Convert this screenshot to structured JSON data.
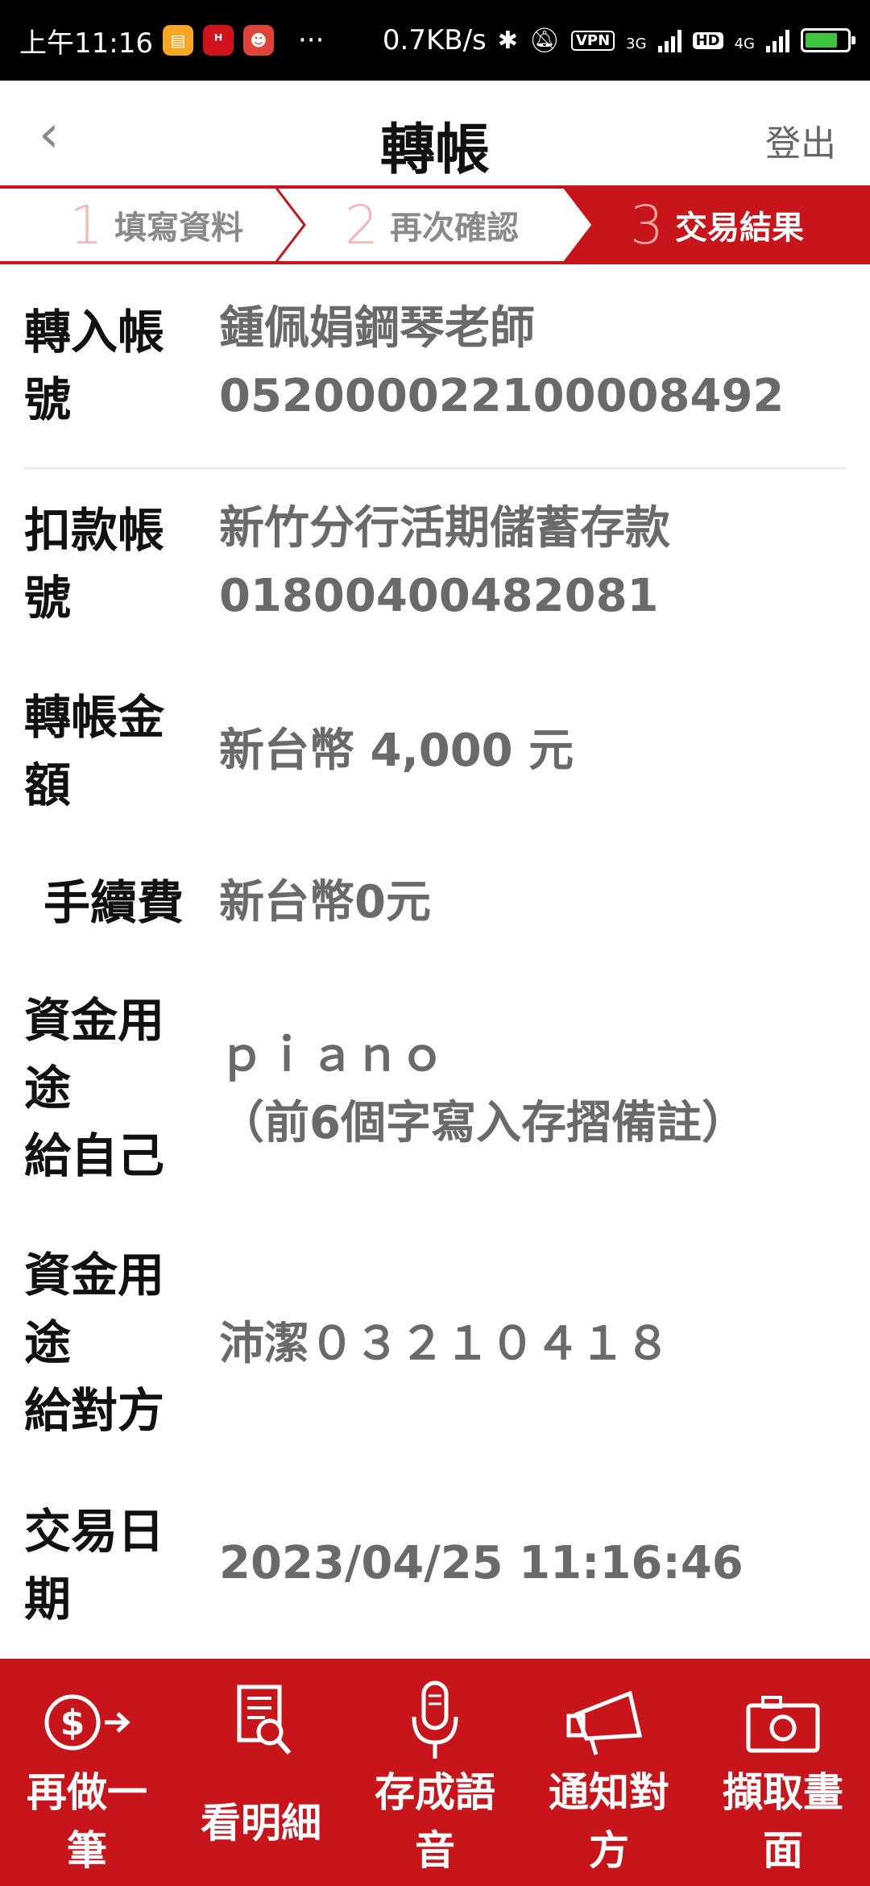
{
  "status_bar": {
    "time": "上午11:16",
    "dots": "···",
    "speed": "0.7KB/s",
    "vpn": "VPN",
    "net1": "3G",
    "hd": "HD",
    "net2": "4G"
  },
  "header": {
    "back_icon": "chevron-left-icon",
    "title": "轉帳",
    "logout_label": "登出"
  },
  "stepper": {
    "steps": [
      {
        "num": "1",
        "label": "填寫資料"
      },
      {
        "num": "2",
        "label": "再次確認"
      },
      {
        "num": "3",
        "label": "交易結果"
      }
    ],
    "active_index": 2,
    "accent_color": "#c8151b"
  },
  "details": {
    "to_account": {
      "label_line1": "轉入帳",
      "label_line2": "號",
      "value_line1": "鍾佩娟鋼琴老師",
      "value_line2": "052000022100008492"
    },
    "from_account": {
      "label_line1": "扣款帳",
      "label_line2": "號",
      "value_line1": "新竹分行活期儲蓄存款",
      "value_line2": "01800400482081"
    },
    "amount": {
      "label_line1": "轉帳金",
      "label_line2": "額",
      "value": "新台幣 4,000 元"
    },
    "fee": {
      "label": "手續費",
      "value": "新台幣0元"
    },
    "purpose_self": {
      "label_line1": "資金用",
      "label_line2": "途",
      "label_line3": "給自己",
      "value_line1": "ｐｉａｎｏ",
      "value_line2": "（前6個字寫入存摺備註）"
    },
    "purpose_other": {
      "label_line1": "資金用",
      "label_line2": "途",
      "label_line3": "給對方",
      "value": "沛潔０３２１０４１８"
    },
    "date": {
      "label_line1": "交易日",
      "label_line2": "期",
      "value": "2023/04/25 11:16:46"
    }
  },
  "actions": [
    {
      "icon": "dollar-arrow-icon",
      "line1": "再做一",
      "line2": "筆"
    },
    {
      "icon": "document-search-icon",
      "line1": "看明細",
      "line2": ""
    },
    {
      "icon": "microphone-icon",
      "line1": "存成語",
      "line2": "音"
    },
    {
      "icon": "megaphone-icon",
      "line1": "通知對",
      "line2": "方"
    },
    {
      "icon": "camera-icon",
      "line1": "擷取畫",
      "line2": "面"
    }
  ]
}
